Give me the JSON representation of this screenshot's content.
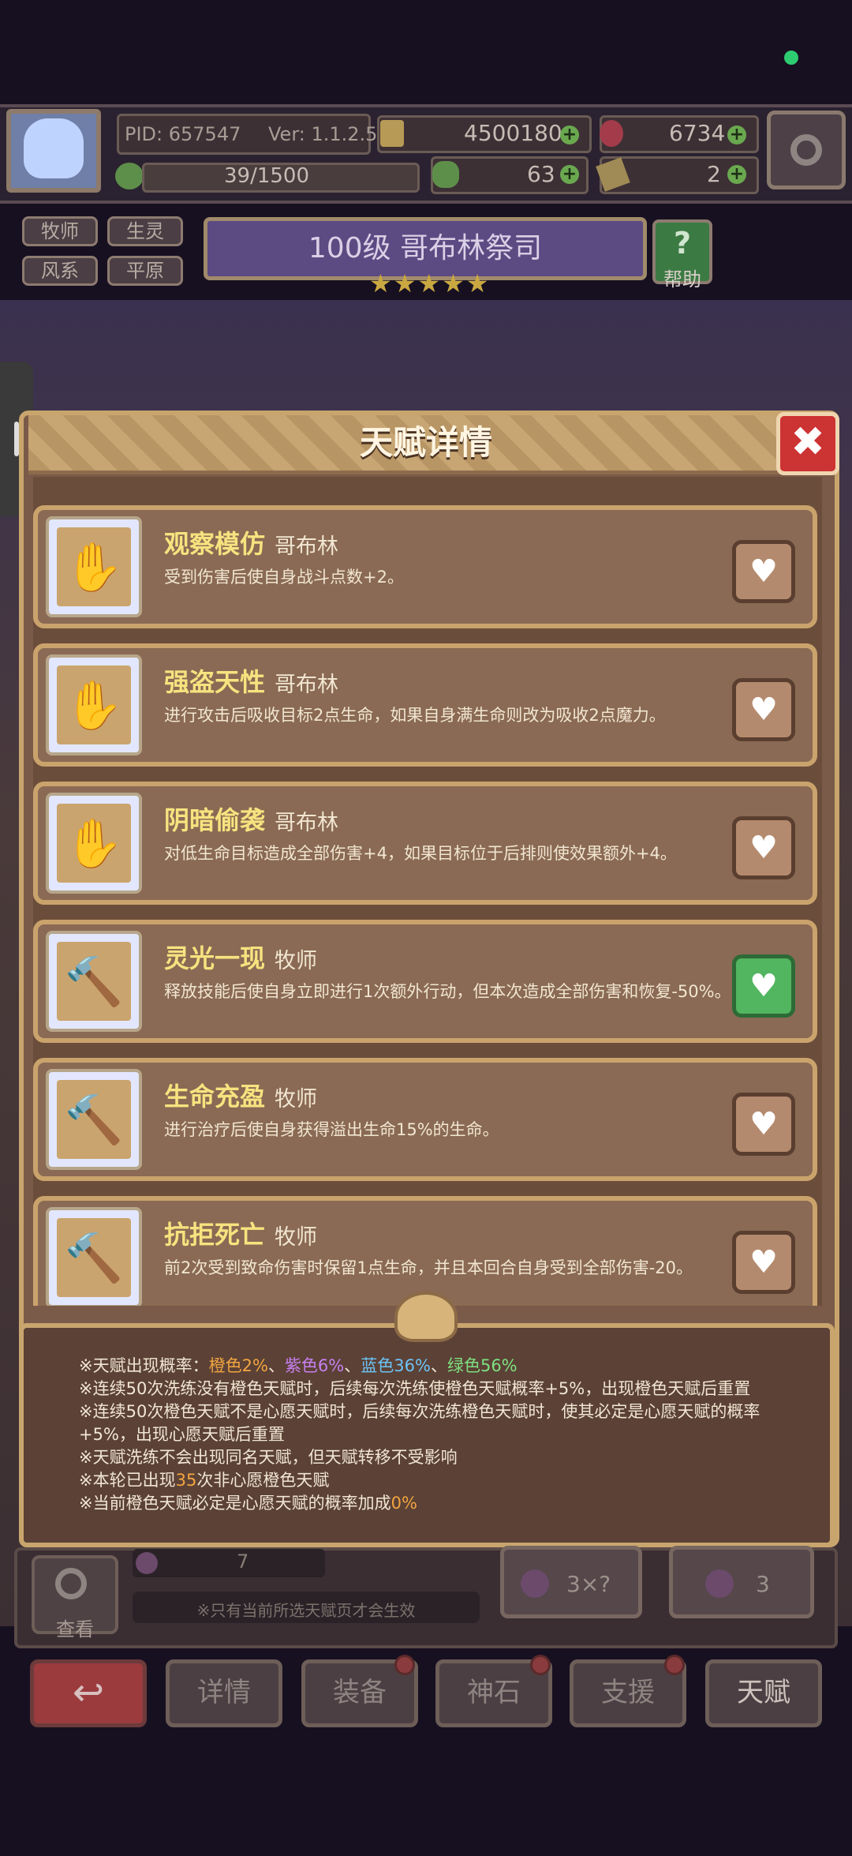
{
  "header": {
    "pid": "PID: 657547",
    "version": "Ver: 1.1.2.5",
    "gold": "4500180",
    "gems": "6734",
    "exp": "39/1500",
    "clover": "63",
    "item2": "2"
  },
  "character": {
    "tags": [
      "牧师",
      "生灵",
      "风系",
      "平原"
    ],
    "title": "100级  哥布林祭司",
    "stars": "★★★★★",
    "help_label": "帮助",
    "help_icon": "?"
  },
  "modal": {
    "title": "天赋详情",
    "close": "✖",
    "talents": [
      {
        "name": "观察模仿",
        "tag": "哥布林",
        "desc_pre": "受到伤害后使自身",
        "desc": "受到伤害后使自身战斗点数+2。",
        "icon": "✋",
        "wish": false
      },
      {
        "name": "强盗天性",
        "tag": "哥布林",
        "desc": "进行攻击后吸收目标2点生命，如果自身满生命则改为吸收2点魔力。",
        "icon": "✋",
        "wish": false
      },
      {
        "name": "阴暗偷袭",
        "tag": "哥布林",
        "desc": "对低生命目标造成全部伤害+4，如果目标位于后排则使效果额外+4。",
        "icon": "✋",
        "wish": false
      },
      {
        "name": "灵光一现",
        "tag": "牧师",
        "desc": "释放技能后使自身立即进行1次额外行动，但本次造成全部伤害和恢复-50%。",
        "icon": "🔨",
        "wish": true
      },
      {
        "name": "生命充盈",
        "tag": "牧师",
        "desc": "进行治疗后使自身获得溢出生命15%的生命。",
        "icon": "🔨",
        "wish": false
      },
      {
        "name": "抗拒死亡",
        "tag": "牧师",
        "desc": "前2次受到致命伤害时保留1点生命，并且本回合自身受到全部伤害-20。",
        "icon": "🔨",
        "wish": false
      }
    ],
    "heart": "♥"
  },
  "info": {
    "line1_pre": "※天赋出现概率：",
    "orange": "橙色2%",
    "purple": "紫色6%",
    "blue": "蓝色36%",
    "green": "绿色56%",
    "sep": "、",
    "line2": "※连续50次洗练没有橙色天赋时，后续每次洗练使橙色天赋概率+5%，出现橙色天赋后重置",
    "line3a": "※连续50次橙色天赋不是心愿天赋时，后续每次洗练橙色天赋时，使其必定是心愿天赋的概率",
    "line3b": "+5%，出现心愿天赋后重置",
    "line4": "※天赋洗练不会出现同名天赋，但天赋转移不受影响",
    "line5_pre": "※本轮已出现",
    "line5_num": "35",
    "line5_post": "次非心愿橙色天赋",
    "line6_pre": "※当前橙色天赋必定是心愿天赋的概率加成",
    "line6_num": "0%"
  },
  "bottom": {
    "view_label": "查看",
    "count": "7",
    "tip": "※只有当前所选天赋页才会生效",
    "auto_wash": "3×?",
    "wash": "3"
  },
  "nav": {
    "back": "↩",
    "items": [
      "详情",
      "装备",
      "神石",
      "支援",
      "天赋"
    ]
  }
}
